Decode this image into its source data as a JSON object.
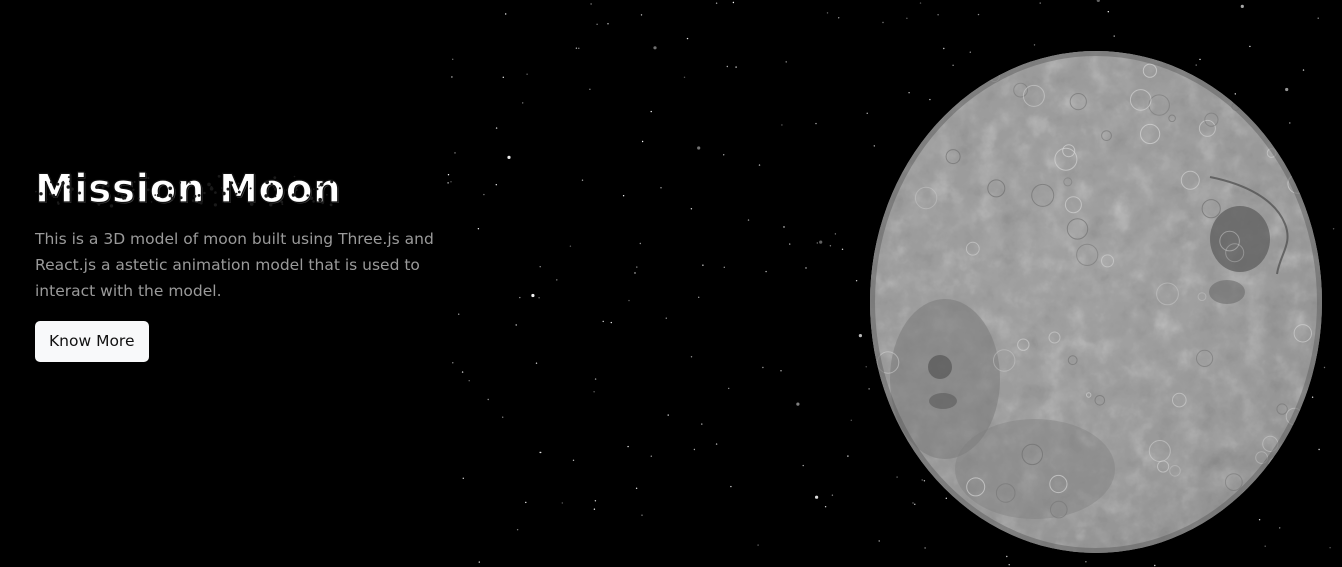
{
  "hero": {
    "title": "Mission Moon",
    "description": "This is a 3D model of moon built using Three.js and React.js a astetic animation model that is used to interact with the model.",
    "cta_label": "Know More"
  },
  "colors": {
    "background": "#000000",
    "title": "#ffffff",
    "description": "#9a9a9a",
    "button_bg": "#f8f9fa",
    "button_text": "#111111",
    "moon_light": "#c9c9c9",
    "moon_dark": "#6e6e6e",
    "star": "#ffffff"
  },
  "icons": {
    "moon": "moon-3d-model"
  }
}
